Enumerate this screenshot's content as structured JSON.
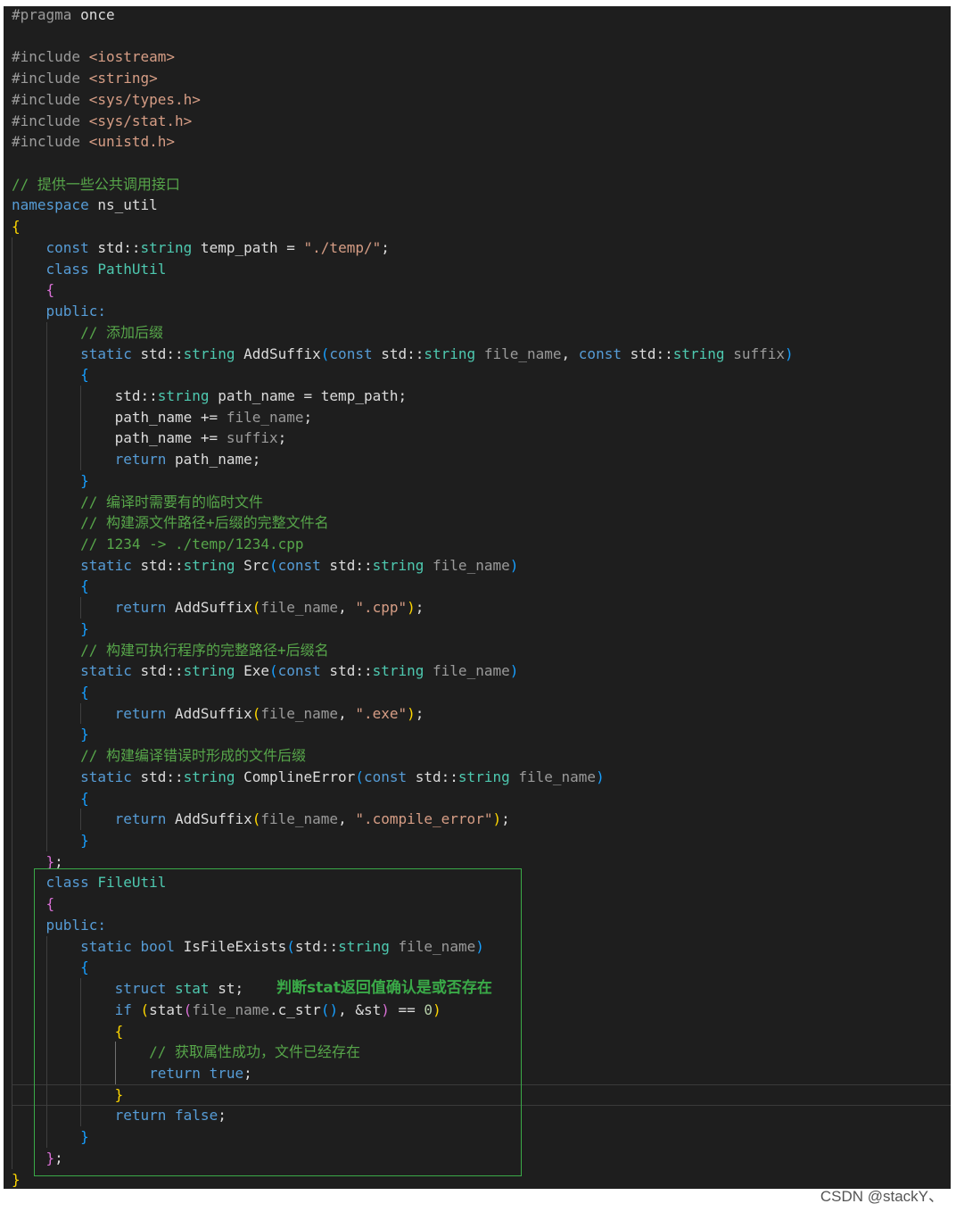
{
  "editor": {
    "background": "#1e1e1e",
    "lines": [
      [
        [
          "#pragma",
          "#9b9b9b"
        ],
        " once"
      ],
      [],
      [
        [
          "#include",
          "#9b9b9b"
        ],
        " ",
        [
          "<iostream>",
          "#d69d85"
        ]
      ],
      [
        [
          "#include",
          "#9b9b9b"
        ],
        " ",
        [
          "<string>",
          "#d69d85"
        ]
      ],
      [
        [
          "#include",
          "#9b9b9b"
        ],
        " ",
        [
          "<sys/types.h>",
          "#d69d85"
        ]
      ],
      [
        [
          "#include",
          "#9b9b9b"
        ],
        " ",
        [
          "<sys/stat.h>",
          "#d69d85"
        ]
      ],
      [
        [
          "#include",
          "#9b9b9b"
        ],
        " ",
        [
          "<unistd.h>",
          "#d69d85"
        ]
      ],
      [],
      [
        [
          "// 提供一些公共调用接口",
          "#57a64a"
        ]
      ],
      [
        [
          "namespace",
          "#569cd6"
        ],
        " ns_util"
      ],
      [
        [
          "{",
          "#ffd700"
        ]
      ],
      [
        "    ",
        [
          "const",
          "#569cd6"
        ],
        " std::",
        [
          "string",
          "#4ec9b0"
        ],
        " temp_path = ",
        [
          "\"./temp/\"",
          "#d69d85"
        ],
        ";"
      ],
      [
        "    ",
        [
          "class",
          "#569cd6"
        ],
        " ",
        [
          "PathUtil",
          "#4ec9b0"
        ]
      ],
      [
        "    ",
        [
          "{",
          "#da70d6"
        ]
      ],
      [
        "    ",
        [
          "public:",
          "#569cd6"
        ]
      ],
      [
        "        ",
        [
          "// 添加后缀",
          "#57a64a"
        ]
      ],
      [
        "        ",
        [
          "static",
          "#569cd6"
        ],
        " std::",
        [
          "string",
          "#4ec9b0"
        ],
        " AddSuffix",
        [
          "(",
          "#179fff"
        ],
        [
          "const",
          "#569cd6"
        ],
        " std::",
        [
          "string",
          "#4ec9b0"
        ],
        " ",
        [
          "file_name",
          "#9a9a9a"
        ],
        ", ",
        [
          "const",
          "#569cd6"
        ],
        " std::",
        [
          "string",
          "#4ec9b0"
        ],
        " ",
        [
          "suffix",
          "#9a9a9a"
        ],
        [
          ")",
          "#179fff"
        ]
      ],
      [
        "        ",
        [
          "{",
          "#179fff"
        ]
      ],
      [
        "            std::",
        [
          "string",
          "#4ec9b0"
        ],
        " path_name = temp_path;"
      ],
      [
        "            path_name += ",
        [
          "file_name",
          "#9a9a9a"
        ],
        ";"
      ],
      [
        "            path_name += ",
        [
          "suffix",
          "#9a9a9a"
        ],
        ";"
      ],
      [
        "            ",
        [
          "return",
          "#569cd6"
        ],
        " path_name;"
      ],
      [
        "        ",
        [
          "}",
          "#179fff"
        ]
      ],
      [
        "        ",
        [
          "// 编译时需要有的临时文件",
          "#57a64a"
        ]
      ],
      [
        "        ",
        [
          "// 构建源文件路径+后缀的完整文件名",
          "#57a64a"
        ]
      ],
      [
        "        ",
        [
          "// 1234 -> ./temp/1234.cpp",
          "#57a64a"
        ]
      ],
      [
        "        ",
        [
          "static",
          "#569cd6"
        ],
        " std::",
        [
          "string",
          "#4ec9b0"
        ],
        " Src",
        [
          "(",
          "#179fff"
        ],
        [
          "const",
          "#569cd6"
        ],
        " std::",
        [
          "string",
          "#4ec9b0"
        ],
        " ",
        [
          "file_name",
          "#9a9a9a"
        ],
        [
          ")",
          "#179fff"
        ]
      ],
      [
        "        ",
        [
          "{",
          "#179fff"
        ]
      ],
      [
        "            ",
        [
          "return",
          "#569cd6"
        ],
        " AddSuffix",
        [
          "(",
          "#ffd700"
        ],
        [
          "file_name",
          "#9a9a9a"
        ],
        ", ",
        [
          "\".cpp\"",
          "#d69d85"
        ],
        [
          ")",
          "#ffd700"
        ],
        ";"
      ],
      [
        "        ",
        [
          "}",
          "#179fff"
        ]
      ],
      [
        "        ",
        [
          "// 构建可执行程序的完整路径+后缀名",
          "#57a64a"
        ]
      ],
      [
        "        ",
        [
          "static",
          "#569cd6"
        ],
        " std::",
        [
          "string",
          "#4ec9b0"
        ],
        " Exe",
        [
          "(",
          "#179fff"
        ],
        [
          "const",
          "#569cd6"
        ],
        " std::",
        [
          "string",
          "#4ec9b0"
        ],
        " ",
        [
          "file_name",
          "#9a9a9a"
        ],
        [
          ")",
          "#179fff"
        ]
      ],
      [
        "        ",
        [
          "{",
          "#179fff"
        ]
      ],
      [
        "            ",
        [
          "return",
          "#569cd6"
        ],
        " AddSuffix",
        [
          "(",
          "#ffd700"
        ],
        [
          "file_name",
          "#9a9a9a"
        ],
        ", ",
        [
          "\".exe\"",
          "#d69d85"
        ],
        [
          ")",
          "#ffd700"
        ],
        ";"
      ],
      [
        "        ",
        [
          "}",
          "#179fff"
        ]
      ],
      [
        "        ",
        [
          "// 构建编译错误时形成的文件后缀",
          "#57a64a"
        ]
      ],
      [
        "        ",
        [
          "static",
          "#569cd6"
        ],
        " std::",
        [
          "string",
          "#4ec9b0"
        ],
        " ComplineError",
        [
          "(",
          "#179fff"
        ],
        [
          "const",
          "#569cd6"
        ],
        " std::",
        [
          "string",
          "#4ec9b0"
        ],
        " ",
        [
          "file_name",
          "#9a9a9a"
        ],
        [
          ")",
          "#179fff"
        ]
      ],
      [
        "        ",
        [
          "{",
          "#179fff"
        ]
      ],
      [
        "            ",
        [
          "return",
          "#569cd6"
        ],
        " AddSuffix",
        [
          "(",
          "#ffd700"
        ],
        [
          "file_name",
          "#9a9a9a"
        ],
        ", ",
        [
          "\".compile_error\"",
          "#d69d85"
        ],
        [
          ")",
          "#ffd700"
        ],
        ";"
      ],
      [
        "        ",
        [
          "}",
          "#179fff"
        ]
      ],
      [
        "    ",
        [
          "}",
          "#da70d6"
        ],
        ";"
      ],
      [
        "    ",
        [
          "class",
          "#569cd6"
        ],
        " ",
        [
          "FileUtil",
          "#4ec9b0"
        ]
      ],
      [
        "    ",
        [
          "{",
          "#da70d6"
        ]
      ],
      [
        "    ",
        [
          "public:",
          "#569cd6"
        ]
      ],
      [
        "        ",
        [
          "static",
          "#569cd6"
        ],
        " ",
        [
          "bool",
          "#569cd6"
        ],
        " IsFileExists",
        [
          "(",
          "#179fff"
        ],
        "std::",
        [
          "string",
          "#4ec9b0"
        ],
        " ",
        [
          "file_name",
          "#9a9a9a"
        ],
        [
          ")",
          "#179fff"
        ]
      ],
      [
        "        ",
        [
          "{",
          "#179fff"
        ]
      ],
      [
        "            ",
        [
          "struct",
          "#569cd6"
        ],
        " ",
        [
          "stat",
          "#4ec9b0"
        ],
        " st;"
      ],
      [
        "            ",
        [
          "if",
          "#569cd6"
        ],
        " ",
        [
          "(",
          "#ffd700"
        ],
        "stat",
        [
          "(",
          "#da70d6"
        ],
        [
          "file_name",
          "#9a9a9a"
        ],
        ".c_str",
        [
          "()",
          "#179fff"
        ],
        ", &st",
        [
          ")",
          "#da70d6"
        ],
        " == ",
        [
          "0",
          "#b5cea8"
        ],
        [
          ")",
          "#ffd700"
        ]
      ],
      [
        "            ",
        [
          "{",
          "#ffd700"
        ]
      ],
      [
        "                ",
        [
          "// 获取属性成功，文件已经存在",
          "#57a64a"
        ]
      ],
      [
        "                ",
        [
          "return",
          "#569cd6"
        ],
        " ",
        [
          "true",
          "#569cd6"
        ],
        ";"
      ],
      [
        "            ",
        [
          "}",
          "#ffd700"
        ]
      ],
      [
        "            ",
        [
          "return",
          "#569cd6"
        ],
        " ",
        [
          "false",
          "#569cd6"
        ],
        ";"
      ],
      [
        "        ",
        [
          "}",
          "#179fff"
        ]
      ],
      [
        "    ",
        [
          "}",
          "#da70d6"
        ],
        ";"
      ],
      [
        [
          "}",
          "#ffd700"
        ]
      ]
    ]
  },
  "annotation": {
    "text": "判断stat返回值确认是或否存在",
    "color": "#3aaa48"
  },
  "watermark": "CSDN @stackY、"
}
